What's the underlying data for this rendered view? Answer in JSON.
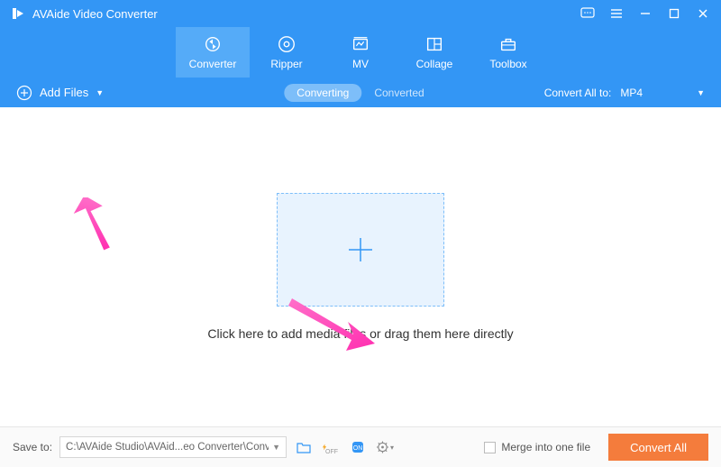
{
  "titlebar": {
    "title": "AVAide Video Converter"
  },
  "tabs": [
    {
      "label": "Converter"
    },
    {
      "label": "Ripper"
    },
    {
      "label": "MV"
    },
    {
      "label": "Collage"
    },
    {
      "label": "Toolbox"
    }
  ],
  "toolbar": {
    "add_files_label": "Add Files",
    "subtabs": [
      {
        "label": "Converting"
      },
      {
        "label": "Converted"
      }
    ],
    "convert_all_to_label": "Convert All to:",
    "format_value": "MP4"
  },
  "main": {
    "drop_hint": "Click here to add media files or drag them here directly"
  },
  "footer": {
    "save_to_label": "Save to:",
    "save_path": "C:\\AVAide Studio\\AVAid...eo Converter\\Converted",
    "merge_label": "Merge into one file",
    "convert_button": "Convert All"
  }
}
